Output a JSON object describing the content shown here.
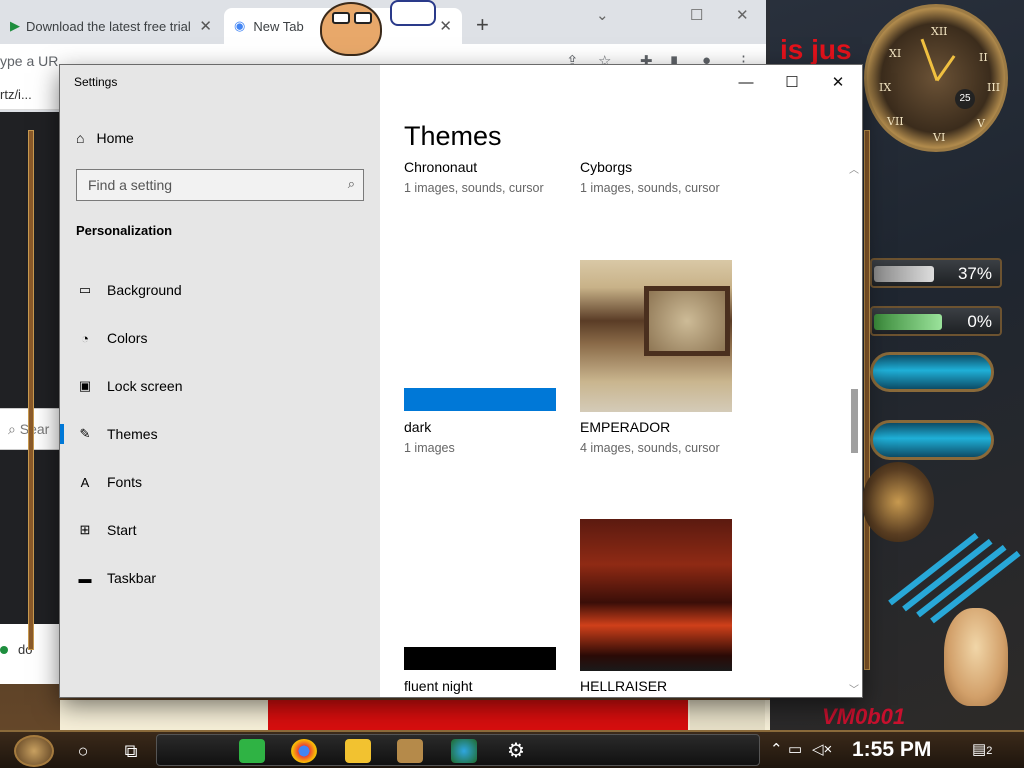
{
  "browser": {
    "tabs": [
      {
        "label": "Download the latest free trial"
      },
      {
        "label": "New Tab"
      }
    ],
    "omnibox_text": "ype a UR",
    "bookmark_text": "rtz/i...",
    "page_search_text": "Sear",
    "download_text": "do"
  },
  "desktop": {
    "red_banner": "is jus",
    "clock_date": "25",
    "meter_1": "37%",
    "meter_2": "0%",
    "signature": "VM0b01"
  },
  "settings": {
    "window_title": "Settings",
    "home_label": "Home",
    "search_placeholder": "Find a setting",
    "section_header": "Personalization",
    "nav": [
      {
        "label": "Background",
        "icon": "image-icon"
      },
      {
        "label": "Colors",
        "icon": "palette-icon"
      },
      {
        "label": "Lock screen",
        "icon": "lock-screen-icon"
      },
      {
        "label": "Themes",
        "icon": "brush-icon",
        "active": true
      },
      {
        "label": "Fonts",
        "icon": "fonts-icon"
      },
      {
        "label": "Start",
        "icon": "start-icon"
      },
      {
        "label": "Taskbar",
        "icon": "taskbar-icon"
      }
    ],
    "page_title": "Themes",
    "themes": [
      {
        "name": "Chrononaut",
        "desc": "1 images, sounds, cursor"
      },
      {
        "name": "Cyborgs",
        "desc": "1 images, sounds, cursor"
      },
      {
        "name": "dark",
        "desc": "1 images",
        "accent": "#0078d7"
      },
      {
        "name": "EMPERADOR",
        "desc": "4 images, sounds, cursor"
      },
      {
        "name": "fluent night",
        "desc": "",
        "accent": "#000000"
      },
      {
        "name": "HELLRAISER",
        "desc": ""
      }
    ]
  },
  "taskbar": {
    "time": "1:55 PM",
    "notification_count": "2"
  }
}
